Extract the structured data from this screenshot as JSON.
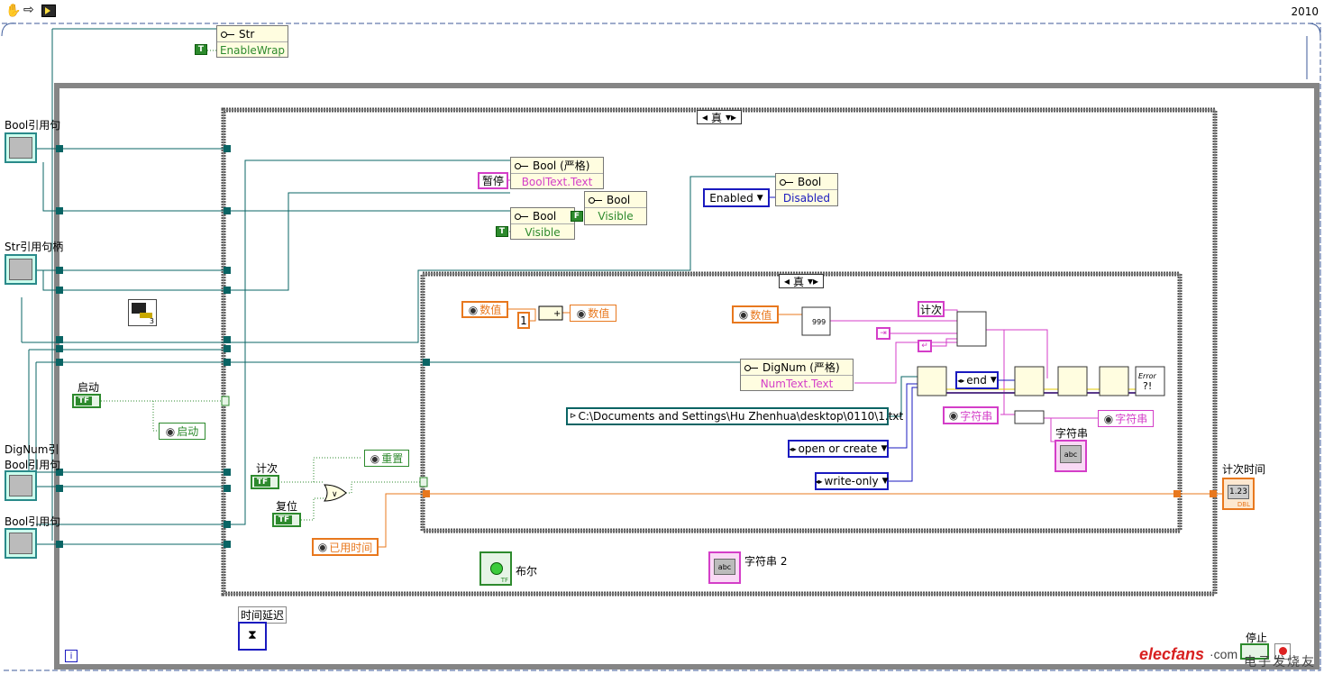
{
  "toolbar": {
    "version": "2010"
  },
  "case_outer": {
    "selector": "真"
  },
  "case_inner": {
    "selector": "真"
  },
  "property_nodes": {
    "str": {
      "name": "Str",
      "prop": "EnableWrap"
    },
    "bool_strict": {
      "name": "Bool (严格)",
      "prop": "BoolText.Text"
    },
    "bool_visible": {
      "name": "Bool",
      "prop": "Visible"
    },
    "bool_visible2": {
      "name": "Bool",
      "prop": "Visible"
    },
    "bool_disabled": {
      "name": "Bool",
      "prop": "Disabled"
    },
    "digi": {
      "name": "DigNum (严格)",
      "prop": "NumText.Text"
    }
  },
  "constants": {
    "pause": "暂停",
    "enabled": "Enabled",
    "one": "1",
    "path": "C:\\Documents and Settings\\Hu Zhenhua\\desktop\\0110\\1.txt",
    "open_mode": "open or create",
    "access": "write-only",
    "end": "end",
    "true_const": "T",
    "false_const": "F"
  },
  "locals": {
    "value_read": "数值",
    "value_write": "数值",
    "value_read2": "数值",
    "start_local": "启动",
    "reset_local": "重置",
    "elapsed": "已用时间",
    "string_local": "字符串",
    "string_local2": "字符串"
  },
  "terminals": {
    "bool_ref1": "Bool引用句",
    "str_ref": "Str引用句柄",
    "dignum_ref": "DigNum引",
    "bool_ref2": "Bool引用句",
    "bool_ref3": "Bool引用句",
    "start": "启动",
    "count": "计次",
    "reset": "复位",
    "bool_term": "布尔",
    "string2": "字符串 2",
    "string_ind": "字符串",
    "count_time": "计次时间",
    "count_const": "计次",
    "delay": "时间延迟",
    "stop": "停止",
    "iteration": "i"
  },
  "watermark": {
    "brand": "elecfans",
    "suffix": "·com",
    "cn": "电子发烧友"
  },
  "colors": {
    "wire_ref": "#0a6464",
    "wire_bool": "#2d8a2d",
    "wire_str": "#d43ec8",
    "wire_num": "#e8781e",
    "wire_enum": "#1a1abf"
  }
}
